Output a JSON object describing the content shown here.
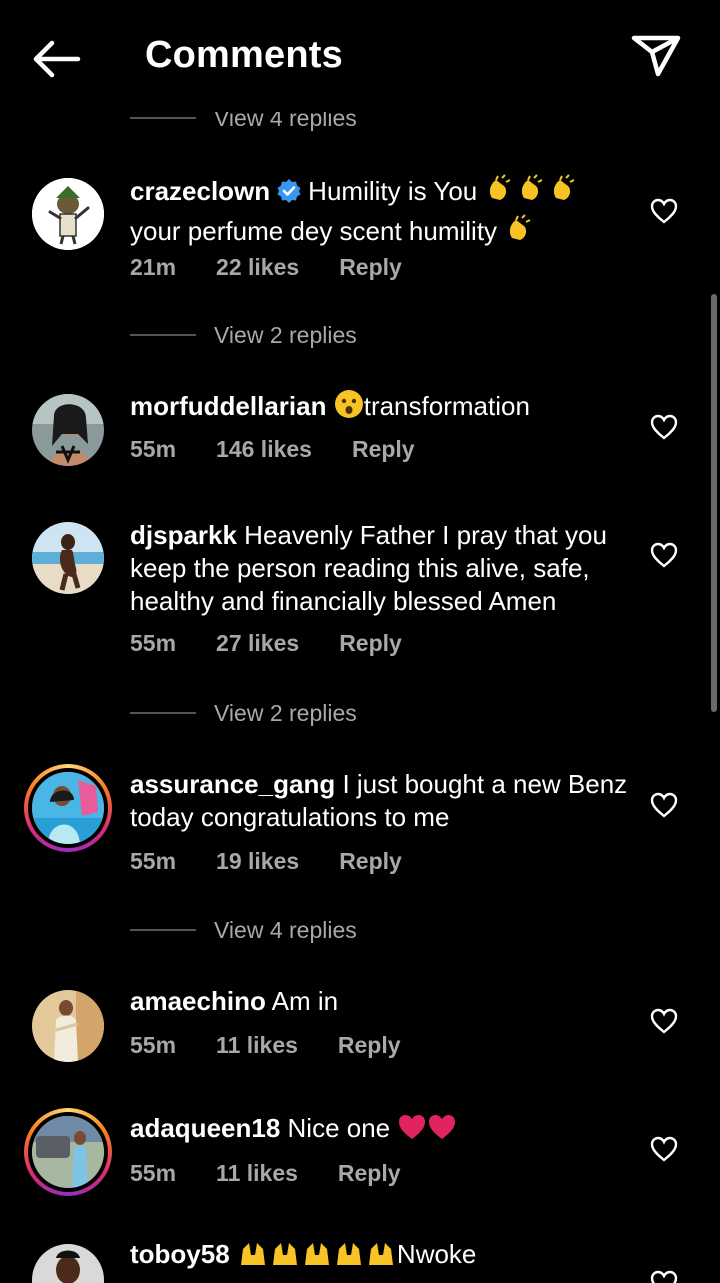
{
  "header": {
    "title": "Comments"
  },
  "icons": {
    "back": "back-arrow-icon",
    "send": "send-icon",
    "heart": "heart-icon",
    "verified": "verified-badge-icon"
  },
  "view_replies": [
    {
      "label": "View 4 replies"
    },
    {
      "label": "View 2 replies"
    },
    {
      "label": "View 2 replies"
    },
    {
      "label": "View 4 replies"
    }
  ],
  "comments": [
    {
      "user": "crazeclown",
      "verified": true,
      "text_1": "Humility is You",
      "text_2": "your perfume dey scent humility",
      "time": "21m",
      "likes": "22 likes",
      "reply": "Reply"
    },
    {
      "user": "morfuddellarian",
      "text": "transformation",
      "time": "55m",
      "likes": "146 likes",
      "reply": "Reply"
    },
    {
      "user": "djsparkk",
      "text": " Heavenly Father I pray that you keep the person reading this alive, safe, healthy and financially blessed Amen",
      "time": "55m",
      "likes": "27 likes",
      "reply": "Reply"
    },
    {
      "user": "assurance_gang",
      "text": " I just bought a new Benz today congratulations to me",
      "time": "55m",
      "likes": "19 likes",
      "reply": "Reply"
    },
    {
      "user": "amaechino",
      "text": " Am in",
      "time": "55m",
      "likes": "11 likes",
      "reply": "Reply"
    },
    {
      "user": "adaqueen18",
      "text": " Nice one",
      "time": "55m",
      "likes": "11 likes",
      "reply": "Reply"
    },
    {
      "user": "toboy58",
      "text": "Nwoke"
    }
  ],
  "colors": {
    "background": "#000000",
    "secondary_text": "#a8a8a8",
    "verified": "#3897f0",
    "heart_emoji": "#e0245e"
  }
}
